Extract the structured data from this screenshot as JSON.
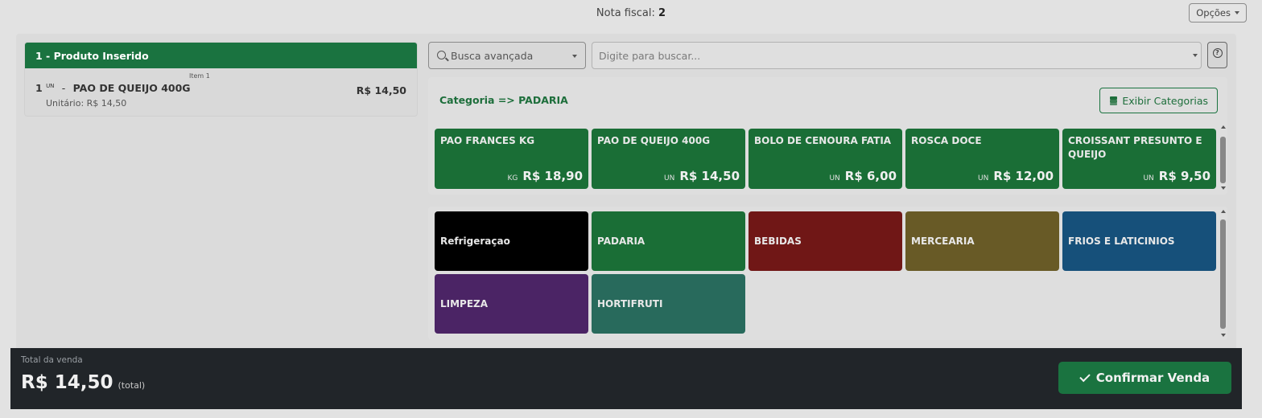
{
  "header": {
    "nota_label": "Nota fiscal:",
    "nota_number": "2",
    "options_label": "Opções"
  },
  "cart": {
    "header": "1 - Produto Inserido",
    "items": [
      {
        "item_tag": "Item 1",
        "qty": "1",
        "unit": "UN",
        "separator": "-",
        "name": "PAO DE QUEIJO 400G",
        "price": "R$ 14,50",
        "unit_price": "Unitário: R$ 14,50"
      }
    ]
  },
  "search": {
    "mode_label": "Busca avançada",
    "placeholder": "Digite para buscar..."
  },
  "category": {
    "title": "Categoria => PADARIA",
    "show_button": "Exibir Categorias"
  },
  "products": [
    {
      "name": "PAO FRANCES KG",
      "unit": "KG",
      "price": "R$ 18,90"
    },
    {
      "name": "PAO DE QUEIJO 400G",
      "unit": "UN",
      "price": "R$ 14,50"
    },
    {
      "name": "BOLO DE CENOURA FATIA",
      "unit": "UN",
      "price": "R$ 6,00"
    },
    {
      "name": "ROSCA DOCE",
      "unit": "UN",
      "price": "R$ 12,00"
    },
    {
      "name": "CROISSANT PRESUNTO E QUEIJO",
      "unit": "UN",
      "price": "R$ 9,50"
    }
  ],
  "groups": [
    {
      "label": "Refrigeraçao",
      "color": "#000000"
    },
    {
      "label": "PADARIA",
      "color": "#1a6e36"
    },
    {
      "label": "BEBIDAS",
      "color": "#701716"
    },
    {
      "label": "MERCEARIA",
      "color": "#685a26"
    },
    {
      "label": "FRIOS E LATICINIOS",
      "color": "#16507a"
    },
    {
      "label": "LIMPEZA",
      "color": "#4b2465"
    },
    {
      "label": "HORTIFRUTI",
      "color": "#286a5c"
    }
  ],
  "footer": {
    "total_label": "Total da venda",
    "total_value": "R$ 14,50",
    "total_suffix": "(total)",
    "confirm_label": "Confirmar Venda"
  }
}
